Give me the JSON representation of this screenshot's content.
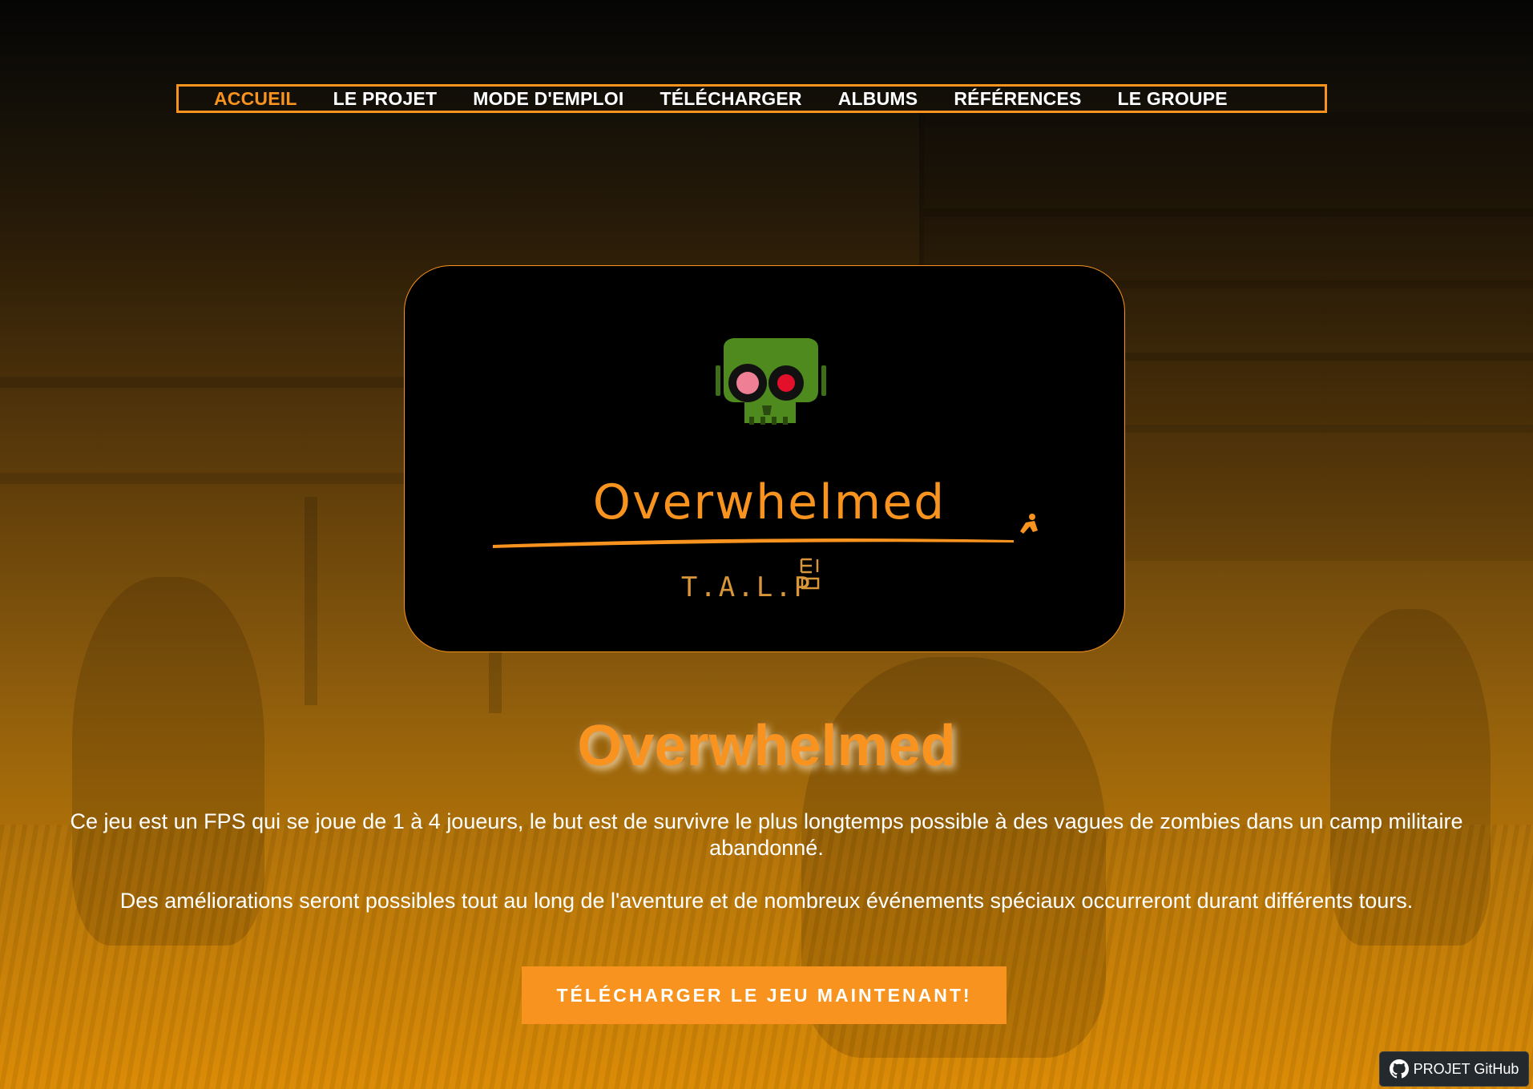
{
  "nav": {
    "items": [
      {
        "label": "ACCUEIL",
        "active": true
      },
      {
        "label": "LE PROJET",
        "active": false
      },
      {
        "label": "MODE D'EMPLOI",
        "active": false
      },
      {
        "label": "TÉLÉCHARGER",
        "active": false
      },
      {
        "label": "ALBUMS",
        "active": false
      },
      {
        "label": "RÉFÉRENCES",
        "active": false
      },
      {
        "label": "LE GROUPE",
        "active": false
      }
    ]
  },
  "logo": {
    "wordmark": "Overwhelmed",
    "studio": "T.A.L.P",
    "icon": "zombie-skull-icon"
  },
  "main": {
    "title": "Overwhelmed",
    "description_1": "Ce jeu est un FPS qui se joue de 1 à 4 joueurs, le but est de survivre le plus longtemps possible à des vagues de zombies dans un camp militaire abandonné.",
    "description_2": "Des améliorations seront possibles tout au long de l'aventure et de nombreux événements spéciaux occurreront durant différents tours.",
    "cta_label": "TÉLÉCHARGER LE JEU MAINTENANT!"
  },
  "github": {
    "label": "PROJET GitHub",
    "icon": "github-icon"
  },
  "colors": {
    "accent": "#f7931e",
    "text": "#ffffff",
    "logo_bg": "#000000",
    "skull_green": "#4e8a1e",
    "eye_red": "#e3102a",
    "eye_pink": "#ef7f95"
  }
}
